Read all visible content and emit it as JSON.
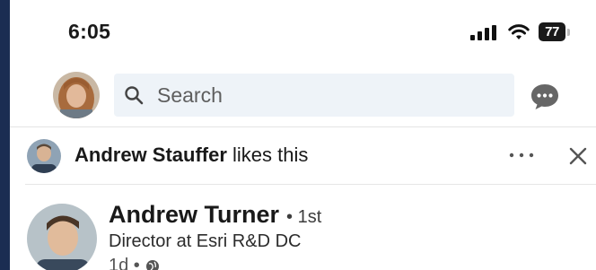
{
  "status_bar": {
    "time": "6:05",
    "battery": "77",
    "icons": [
      "signal-icon",
      "wifi-icon",
      "battery-icon"
    ]
  },
  "header": {
    "search_placeholder": "Search",
    "icons": [
      "search-icon",
      "messaging-icon"
    ]
  },
  "activity": {
    "actor_name": "Andrew Stauffer",
    "action_text": " likes this"
  },
  "post": {
    "author_name": "Andrew Turner",
    "connection_degree": "• 1st",
    "headline": "Director at Esri R&D DC",
    "time_ago": "1d •"
  },
  "colors": {
    "left_bar": "#1b2d52",
    "search_background": "#eef3f8",
    "text_primary": "#191919"
  }
}
